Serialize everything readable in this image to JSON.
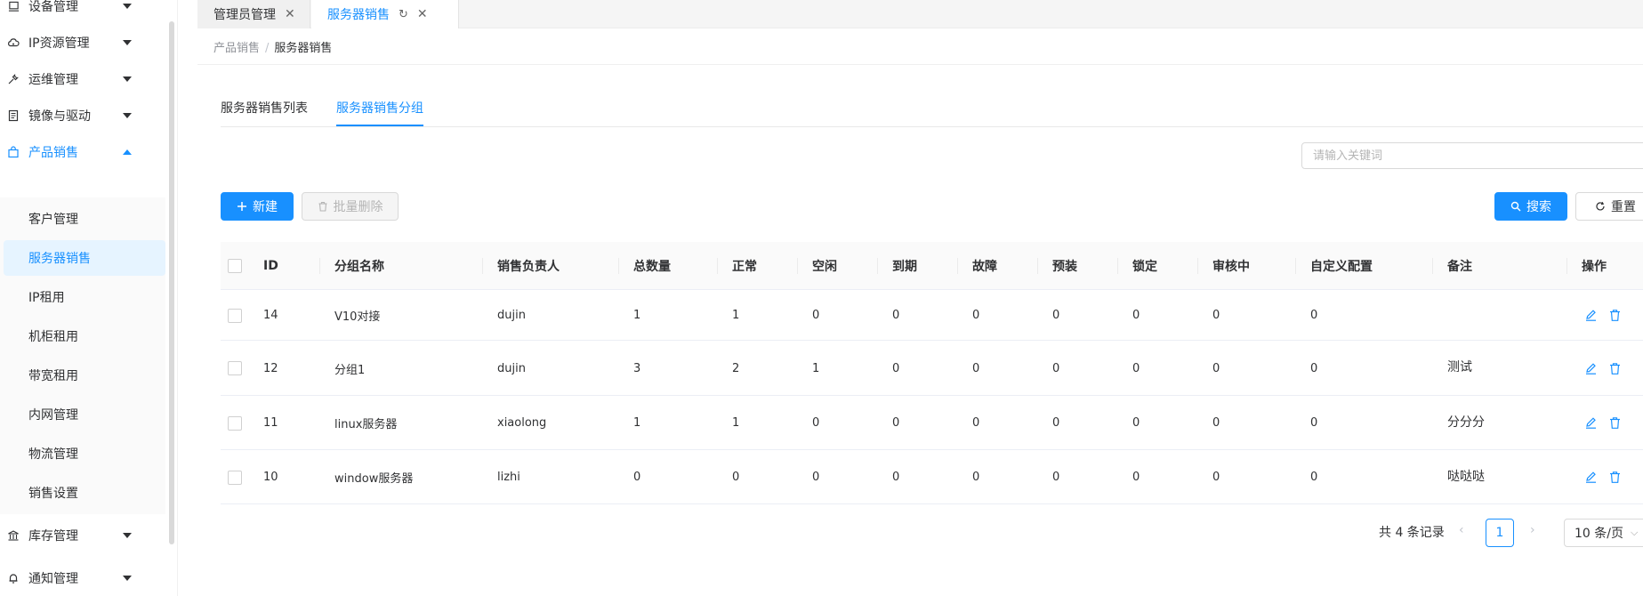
{
  "sidebar": {
    "items": [
      {
        "label": "设备管理",
        "icon": "monitor-icon"
      },
      {
        "label": "IP资源管理",
        "icon": "cloud-icon"
      },
      {
        "label": "运维管理",
        "icon": "wrench-icon"
      },
      {
        "label": "镜像与驱动",
        "icon": "book-icon"
      },
      {
        "label": "产品销售",
        "icon": "bag-icon"
      },
      {
        "label": "库存管理",
        "icon": "bank-icon"
      },
      {
        "label": "通知管理",
        "icon": "bell-icon"
      }
    ],
    "subitems": [
      "客户管理",
      "服务器销售",
      "IP租用",
      "机柜租用",
      "带宽租用",
      "内网管理",
      "物流管理",
      "销售设置"
    ],
    "active_sub": "服务器销售"
  },
  "tabs": [
    {
      "label": "管理员管理",
      "active": false
    },
    {
      "label": "服务器销售",
      "active": true
    }
  ],
  "breadcrumb": {
    "parent": "产品销售",
    "separator": "/",
    "current": "服务器销售"
  },
  "content_tabs": [
    "服务器销售列表",
    "服务器销售分组"
  ],
  "search": {
    "placeholder": "请输入关键词",
    "value": ""
  },
  "toolbar": {
    "new_label": "新建",
    "batch_delete_label": "批量删除",
    "search_label": "搜索",
    "reset_label": "重置"
  },
  "table": {
    "headers": [
      "ID",
      "分组名称",
      "销售负责人",
      "总数量",
      "正常",
      "空闲",
      "到期",
      "故障",
      "预装",
      "锁定",
      "审核中",
      "自定义配置",
      "备注",
      "操作"
    ],
    "rows": [
      {
        "id": "14",
        "name": "V10对接",
        "owner": "dujin",
        "total": "1",
        "normal": "1",
        "idle": "0",
        "expired": "0",
        "fault": "0",
        "preinstall": "0",
        "locked": "0",
        "reviewing": "0",
        "custom": "0",
        "note": ""
      },
      {
        "id": "12",
        "name": "分组1",
        "owner": "dujin",
        "total": "3",
        "normal": "2",
        "idle": "1",
        "expired": "0",
        "fault": "0",
        "preinstall": "0",
        "locked": "0",
        "reviewing": "0",
        "custom": "0",
        "note": "测试"
      },
      {
        "id": "11",
        "name": "linux服务器",
        "owner": "xiaolong",
        "total": "1",
        "normal": "1",
        "idle": "0",
        "expired": "0",
        "fault": "0",
        "preinstall": "0",
        "locked": "0",
        "reviewing": "0",
        "custom": "0",
        "note": "分分分"
      },
      {
        "id": "10",
        "name": "window服务器",
        "owner": "lizhi",
        "total": "0",
        "normal": "0",
        "idle": "0",
        "expired": "0",
        "fault": "0",
        "preinstall": "0",
        "locked": "0",
        "reviewing": "0",
        "custom": "0",
        "note": "哒哒哒"
      }
    ]
  },
  "pagination": {
    "total_text": "共 4 条记录",
    "current_page": "1",
    "page_size": "10 条/页"
  },
  "colors": {
    "accent": "#1890ff",
    "accent_light": "#e6f4ff"
  }
}
